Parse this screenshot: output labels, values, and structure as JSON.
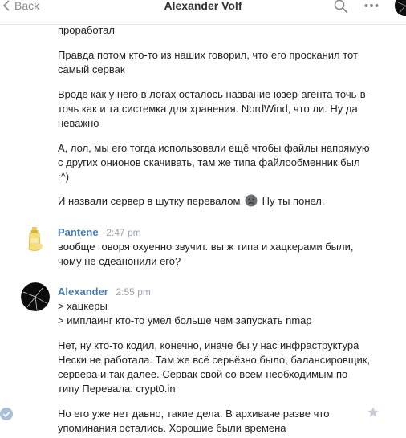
{
  "header": {
    "back_label": "Back",
    "title": "Alexander Volf"
  },
  "icons": {
    "back": "chevron-left-icon",
    "search": "search-icon",
    "more": "more-dots-icon"
  },
  "messages": {
    "block0": {
      "p0": "проработал",
      "p1": "Правда потом кто-то из наших говорил, что его просканил тот самый сервак",
      "p2": "Вроде как у него в логах осталось название юзер-агента точь-в-точь как и та системка для хранения. NordWind, что ли. Ну да неважно",
      "p3": "А, лол, мы его тогда использовали ещё чтобы файлы напрямую с других онионов скачивать, там же типа файлообменник был :^)",
      "p4a": "И назвали сервер в шутку перевалом",
      "p4b": "Ну ты понел."
    },
    "block1": {
      "sender": "Pantene",
      "time": "2:47 pm",
      "p0": "вообще говоря охуенно звучит. вы ж типа и хацкерами были, чому не сдеанонили его?"
    },
    "block2": {
      "sender": "Alexander",
      "time": "2:55 pm",
      "p0a": "> хацкеры",
      "p0b": "> имплаинг кто-то умел больше чем запускать nmap",
      "p1": "Нет, ну кто-то кодил, конечно, иначе бы у нас инфраструктура Нески не работала. Там же всё серьёзно было, балансировщик, сервера и так далее. Сервак свой со всем необходимым по типу Перевала: crypt0.in",
      "p2": "Но его уже нет давно, такие дела. В архиваче разве что упоминания остались. Хорошие были времена"
    }
  },
  "colors": {
    "sender": "#4a7cae",
    "time": "#9aa3ad",
    "check": "#a9bfd6",
    "star": "#c9ced6"
  }
}
